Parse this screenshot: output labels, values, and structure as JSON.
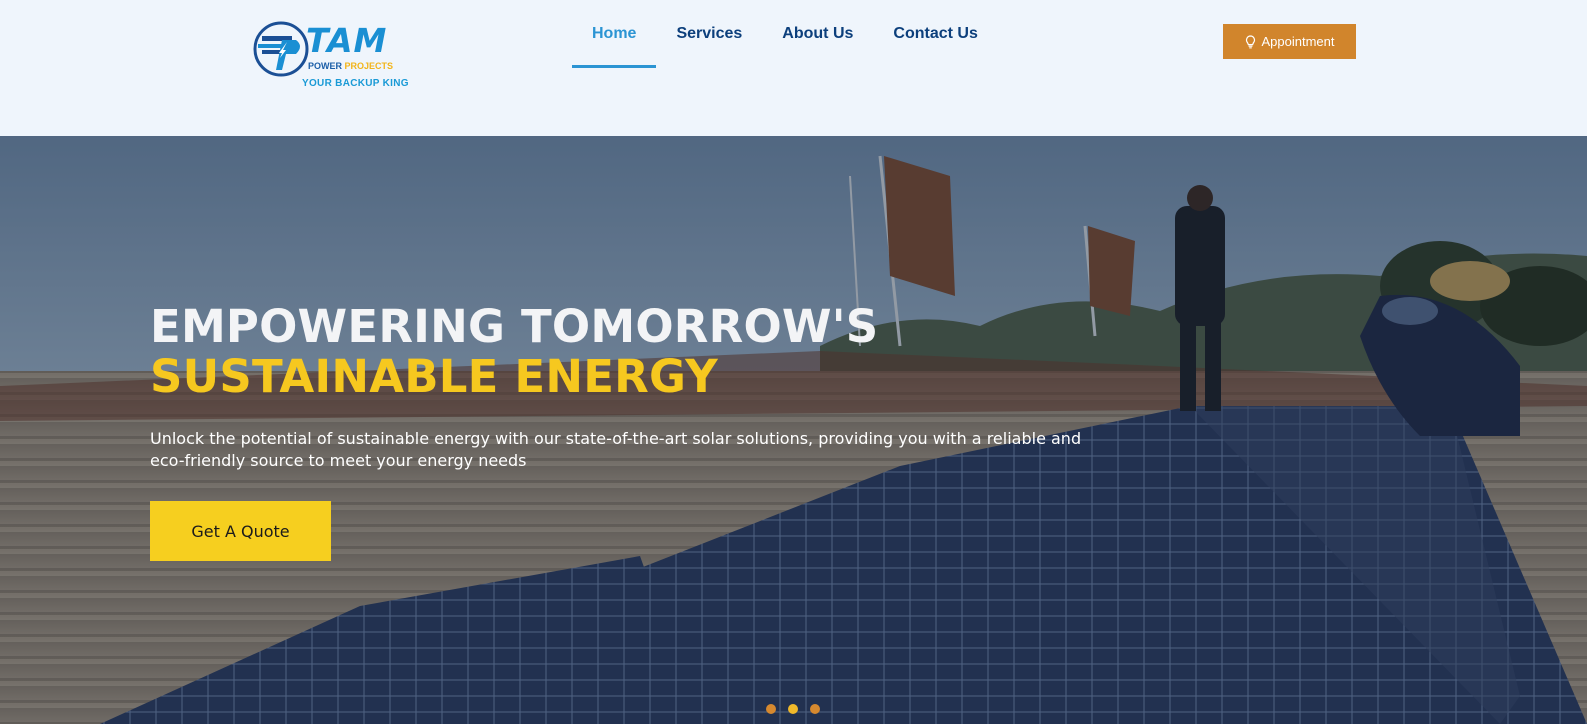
{
  "header": {
    "logo": {
      "wordmark": "TAM",
      "sub_power": "POWER",
      "sub_projects": "PROJECTS",
      "tagline": "YOUR BACKUP KING"
    },
    "nav": [
      {
        "label": "Home",
        "active": true
      },
      {
        "label": "Services",
        "active": false
      },
      {
        "label": "About Us",
        "active": false
      },
      {
        "label": "Contact Us",
        "active": false
      }
    ],
    "appointment_button": {
      "label": "Appointment",
      "icon": "lightbulb-icon"
    }
  },
  "hero": {
    "title_line1": "EMPOWERING TOMORROW'S",
    "title_line2": "SUSTAINABLE ENERGY",
    "description": "Unlock the potential of sustainable energy with our state-of-the-art solar solutions, providing you with a reliable and eco-friendly source to meet your energy needs",
    "cta_label": "Get A Quote",
    "carousel": {
      "slide_count": 3,
      "active_index": 1
    }
  },
  "colors": {
    "brand_blue": "#1a8fd3",
    "nav_dark": "#0c3f7c",
    "accent_orange": "#d1852c",
    "accent_yellow": "#f6c81f"
  }
}
